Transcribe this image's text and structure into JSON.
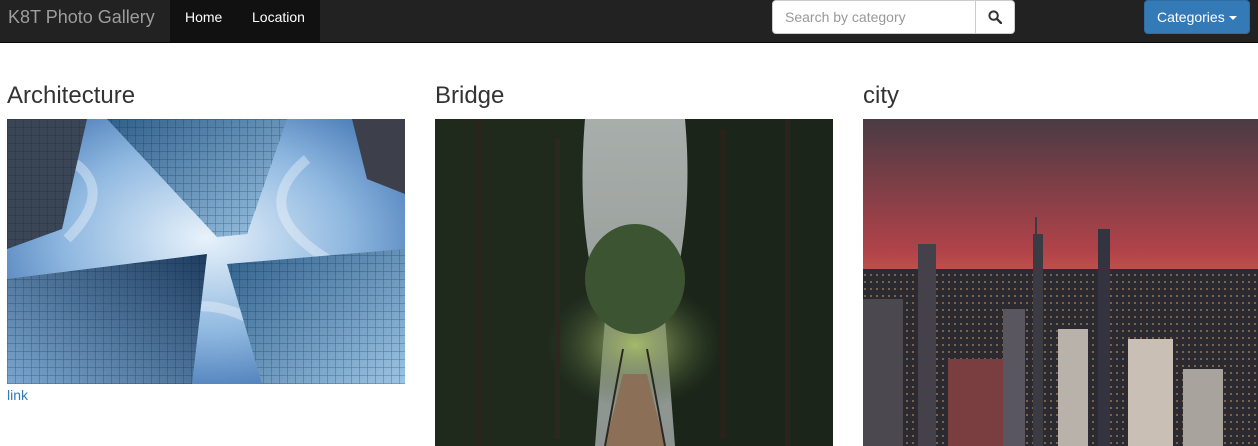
{
  "navbar": {
    "brand": "K8T Photo Gallery",
    "items": [
      {
        "label": "Home"
      },
      {
        "label": "Location"
      }
    ],
    "search": {
      "placeholder": "Search by category",
      "value": ""
    },
    "categories_label": "Categories",
    "colors": {
      "navbar_bg": "#222222",
      "active_item_bg": "#111111",
      "button_primary": "#337ab7"
    }
  },
  "gallery": {
    "cards": [
      {
        "title": "Architecture",
        "link_label": "link",
        "photo": "glass skyscrapers viewed from below"
      },
      {
        "title": "Bridge",
        "photo": "wooden suspension bridge in a forest"
      },
      {
        "title": "city",
        "photo": "aerial city skyline at sunset"
      }
    ],
    "link_color": "#337ab7"
  }
}
